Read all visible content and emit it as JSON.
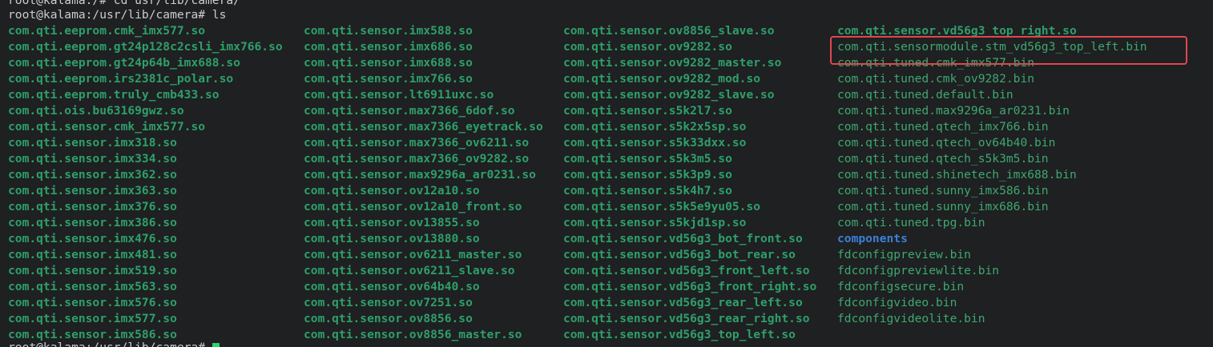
{
  "terminal": {
    "prev_command_line": "root@kalama:/# cd usr/lib/camera/",
    "prompt_line": "root@kalama:/usr/lib/camera# ls",
    "next_prompt": "root@kalama:/usr/lib/camera# ",
    "colors": {
      "background": "#1e2022",
      "shared_object": "#2f9f6a",
      "bin_file": "#3fa86f",
      "directory": "#3d7fd6",
      "highlight_box": "#e0474c",
      "cursor": "#2fd36a"
    }
  },
  "listing": {
    "column1": [
      "com.qti.eeprom.cmk_imx577.so",
      "com.qti.eeprom.gt24p128c2csli_imx766.so",
      "com.qti.eeprom.gt24p64b_imx688.so",
      "com.qti.eeprom.irs2381c_polar.so",
      "com.qti.eeprom.truly_cmb433.so",
      "com.qti.ois.bu63169gwz.so",
      "com.qti.sensor.cmk_imx577.so",
      "com.qti.sensor.imx318.so",
      "com.qti.sensor.imx334.so",
      "com.qti.sensor.imx362.so",
      "com.qti.sensor.imx363.so",
      "com.qti.sensor.imx376.so",
      "com.qti.sensor.imx386.so",
      "com.qti.sensor.imx476.so",
      "com.qti.sensor.imx481.so",
      "com.qti.sensor.imx519.so",
      "com.qti.sensor.imx563.so",
      "com.qti.sensor.imx576.so",
      "com.qti.sensor.imx577.so",
      "com.qti.sensor.imx586.so"
    ],
    "column2": [
      "com.qti.sensor.imx588.so",
      "com.qti.sensor.imx686.so",
      "com.qti.sensor.imx688.so",
      "com.qti.sensor.imx766.so",
      "com.qti.sensor.lt6911uxc.so",
      "com.qti.sensor.max7366_6dof.so",
      "com.qti.sensor.max7366_eyetrack.so",
      "com.qti.sensor.max7366_ov6211.so",
      "com.qti.sensor.max7366_ov9282.so",
      "com.qti.sensor.max9296a_ar0231.so",
      "com.qti.sensor.ov12a10.so",
      "com.qti.sensor.ov12a10_front.so",
      "com.qti.sensor.ov13855.so",
      "com.qti.sensor.ov13880.so",
      "com.qti.sensor.ov6211_master.so",
      "com.qti.sensor.ov6211_slave.so",
      "com.qti.sensor.ov64b40.so",
      "com.qti.sensor.ov7251.so",
      "com.qti.sensor.ov8856.so",
      "com.qti.sensor.ov8856_master.so"
    ],
    "column3": [
      "com.qti.sensor.ov8856_slave.so",
      "com.qti.sensor.ov9282.so",
      "com.qti.sensor.ov9282_master.so",
      "com.qti.sensor.ov9282_mod.so",
      "com.qti.sensor.ov9282_slave.so",
      "com.qti.sensor.s5k2l7.so",
      "com.qti.sensor.s5k2x5sp.so",
      "com.qti.sensor.s5k33dxx.so",
      "com.qti.sensor.s5k3m5.so",
      "com.qti.sensor.s5k3p9.so",
      "com.qti.sensor.s5k4h7.so",
      "com.qti.sensor.s5k5e9yu05.so",
      "com.qti.sensor.s5kjd1sp.so",
      "com.qti.sensor.vd56g3_bot_front.so",
      "com.qti.sensor.vd56g3_bot_rear.so",
      "com.qti.sensor.vd56g3_front_left.so",
      "com.qti.sensor.vd56g3_front_right.so",
      "com.qti.sensor.vd56g3_rear_left.so",
      "com.qti.sensor.vd56g3_rear_right.so",
      "com.qti.sensor.vd56g3_top_left.so"
    ],
    "column4": [
      {
        "name": "com.qti.sensor.vd56g3_top_right.so",
        "kind": "so"
      },
      {
        "name": "com.qti.sensormodule.stm_vd56g3_top_left.bin",
        "kind": "bin",
        "highlighted": true
      },
      {
        "name": "com.qti.tuned.cmk_imx577.bin",
        "kind": "bin"
      },
      {
        "name": "com.qti.tuned.cmk_ov9282.bin",
        "kind": "bin"
      },
      {
        "name": "com.qti.tuned.default.bin",
        "kind": "bin"
      },
      {
        "name": "com.qti.tuned.max9296a_ar0231.bin",
        "kind": "bin"
      },
      {
        "name": "com.qti.tuned.qtech_imx766.bin",
        "kind": "bin"
      },
      {
        "name": "com.qti.tuned.qtech_ov64b40.bin",
        "kind": "bin"
      },
      {
        "name": "com.qti.tuned.qtech_s5k3m5.bin",
        "kind": "bin"
      },
      {
        "name": "com.qti.tuned.shinetech_imx688.bin",
        "kind": "bin"
      },
      {
        "name": "com.qti.tuned.sunny_imx586.bin",
        "kind": "bin"
      },
      {
        "name": "com.qti.tuned.sunny_imx686.bin",
        "kind": "bin"
      },
      {
        "name": "com.qti.tuned.tpg.bin",
        "kind": "bin"
      },
      {
        "name": "components",
        "kind": "dir"
      },
      {
        "name": "fdconfigpreview.bin",
        "kind": "bin"
      },
      {
        "name": "fdconfigpreviewlite.bin",
        "kind": "bin"
      },
      {
        "name": "fdconfigsecure.bin",
        "kind": "bin"
      },
      {
        "name": "fdconfigvideo.bin",
        "kind": "bin"
      },
      {
        "name": "fdconfigvideolite.bin",
        "kind": "bin"
      }
    ]
  }
}
